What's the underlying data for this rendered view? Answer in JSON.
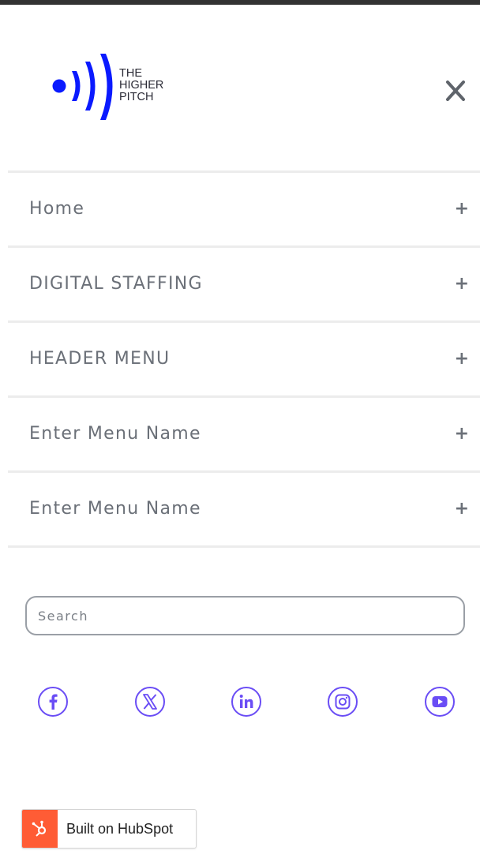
{
  "logo": {
    "lines": [
      "THE",
      "HIGHER",
      "PITCH"
    ],
    "brand_color": "#0a1aff"
  },
  "header": {
    "close_icon": "close-icon"
  },
  "menu": {
    "items": [
      {
        "label": "Home",
        "expand": "+"
      },
      {
        "label": "DIGITAL STAFFING",
        "expand": "+"
      },
      {
        "label": "HEADER MENU",
        "expand": "+"
      },
      {
        "label": "Enter Menu Name",
        "expand": "+"
      },
      {
        "label": "Enter Menu Name",
        "expand": "+"
      }
    ]
  },
  "search": {
    "placeholder": "Search",
    "value": ""
  },
  "social": {
    "icon_color": "#6a4df5",
    "items": [
      {
        "name": "facebook-icon"
      },
      {
        "name": "x-twitter-icon"
      },
      {
        "name": "linkedin-icon"
      },
      {
        "name": "instagram-icon"
      },
      {
        "name": "youtube-icon"
      }
    ]
  },
  "badge": {
    "label": "Built on HubSpot",
    "accent": "#ff5c35"
  }
}
